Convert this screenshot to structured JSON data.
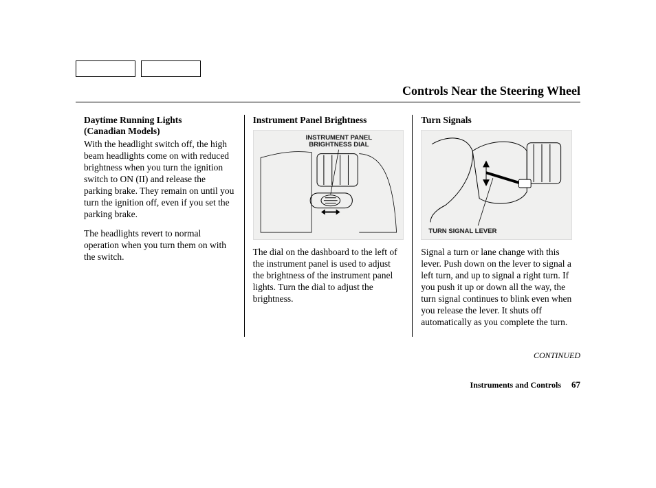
{
  "page_title": "Controls Near the Steering Wheel",
  "col1": {
    "heading_line1": "Daytime Running Lights",
    "heading_line2": "(Canadian Models)",
    "para1": "With the headlight switch off, the high beam headlights come on with reduced brightness when you turn the ignition switch to ON (II) and release the parking brake. They remain on until you turn the ignition off, even if you set the parking brake.",
    "para2": "The headlights revert to normal operation when you turn them on with the switch."
  },
  "col2": {
    "heading": "Instrument Panel Brightness",
    "figure_label_line1": "INSTRUMENT PANEL",
    "figure_label_line2": "BRIGHTNESS DIAL",
    "para1": "The dial on the dashboard to the left of the instrument panel is used to adjust the brightness of the instrument panel lights. Turn the dial to adjust the brightness."
  },
  "col3": {
    "heading": "Turn Signals",
    "figure_label": "TURN SIGNAL LEVER",
    "para1": "Signal a turn or lane change with this lever. Push down on the lever to signal a left turn, and up to signal a right turn. If you push it up or down all the way, the turn signal continues to blink even when you release the lever. It shuts off automatically as you complete the turn."
  },
  "continued": "CONTINUED",
  "footer_section": "Instruments and Controls",
  "footer_page": "67"
}
